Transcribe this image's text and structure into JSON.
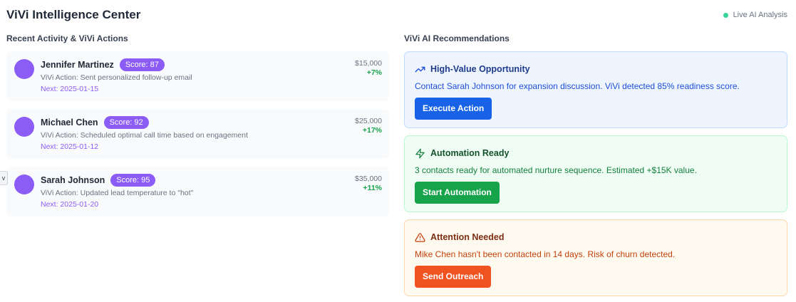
{
  "header": {
    "title": "ViVi Intelligence Center",
    "live_label": "Live AI Analysis",
    "live_dot_color": "#34d399"
  },
  "activity": {
    "section_title": "Recent Activity & ViVi Actions",
    "items": [
      {
        "name": "Jennifer Martinez",
        "score": "Score: 87",
        "action": "ViVi Action: Sent personalized follow-up email",
        "next": "Next: 2025-01-15",
        "value": "$15,000",
        "change": "+7%"
      },
      {
        "name": "Michael Chen",
        "score": "Score: 92",
        "action": "ViVi Action: Scheduled optimal call time based on engagement",
        "next": "Next: 2025-01-12",
        "value": "$25,000",
        "change": "+17%"
      },
      {
        "name": "Sarah Johnson",
        "score": "Score: 95",
        "action": "ViVi Action: Updated lead temperature to \"hot\"",
        "next": "Next: 2025-01-20",
        "value": "$35,000",
        "change": "+11%"
      }
    ]
  },
  "side_tab": {
    "label": "v"
  },
  "recommendations": {
    "section_title": "ViVi AI Recommendations",
    "items": [
      {
        "icon": "trending-up-icon",
        "title": "High-Value Opportunity",
        "text": "Contact Sarah Johnson for expansion discussion. ViVi detected 85% readiness score.",
        "button": "Execute Action",
        "color": "#1762e6"
      },
      {
        "icon": "lightning-icon",
        "title": "Automation Ready",
        "text": "3 contacts ready for automated nurture sequence. Estimated +$15K value.",
        "button": "Start Automation",
        "color": "#16a34a"
      },
      {
        "icon": "warning-icon",
        "title": "Attention Needed",
        "text": "Mike Chen hasn't been contacted in 14 days. Risk of churn detected.",
        "button": "Send Outreach",
        "color": "#f0531f"
      }
    ]
  },
  "colors": {
    "avatar": "#8b5cf6",
    "score_badge": "#8b5cf6",
    "positive_change": "#16a34a"
  }
}
